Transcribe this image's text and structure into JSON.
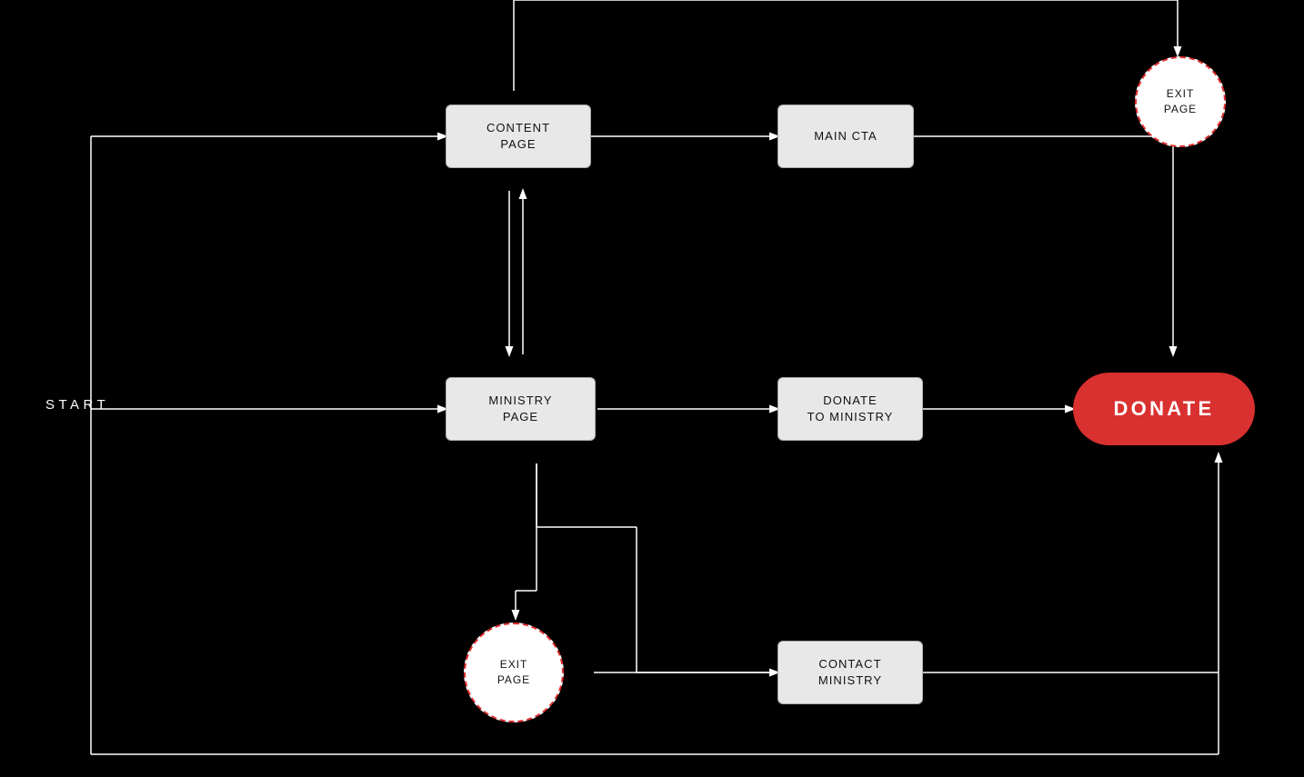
{
  "nodes": {
    "start": {
      "label": "START"
    },
    "content_page": {
      "label": "CONTENT\nPAGE"
    },
    "main_cta": {
      "label": "MAIN CTA"
    },
    "ministry_page": {
      "label": "MINISTRY\nPAGE"
    },
    "donate_to_ministry": {
      "label": "DONATE\nTO MINISTRY"
    },
    "donate_button": {
      "label": "DONATE"
    },
    "exit_page_top": {
      "label": "EXIT\nPAGE"
    },
    "exit_page_bottom": {
      "label": "EXIT\nPAGE"
    },
    "contact_ministry": {
      "label": "CONTACT\nMINISTRY"
    }
  }
}
